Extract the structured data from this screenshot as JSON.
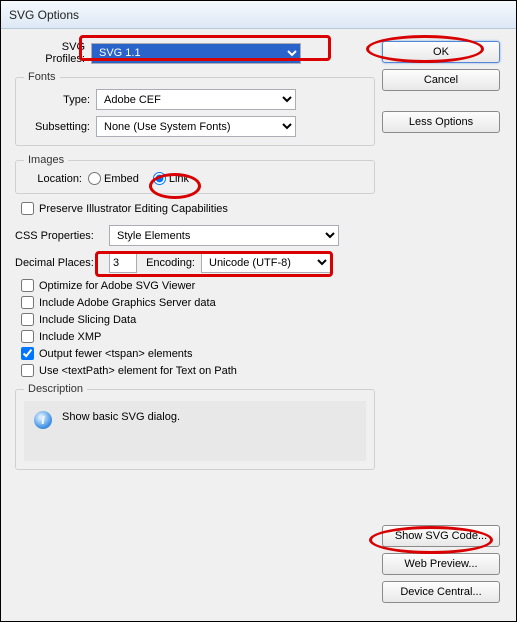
{
  "titlebar": {
    "title": "SVG Options"
  },
  "profiles": {
    "label": "SVG Profiles:",
    "value": "SVG 1.1"
  },
  "fonts": {
    "legend": "Fonts",
    "type_label": "Type:",
    "type_value": "Adobe CEF",
    "subsetting_label": "Subsetting:",
    "subsetting_value": "None (Use System Fonts)"
  },
  "images": {
    "legend": "Images",
    "location_label": "Location:",
    "embed_label": "Embed",
    "link_label": "Link"
  },
  "preserve_label": "Preserve Illustrator Editing Capabilities",
  "css": {
    "label": "CSS Properties:",
    "value": "Style Elements"
  },
  "decimal": {
    "label": "Decimal Places:",
    "value": "3"
  },
  "encoding": {
    "label": "Encoding:",
    "value": "Unicode (UTF-8)"
  },
  "opts": {
    "optimize_viewer": "Optimize for Adobe SVG Viewer",
    "include_graphics_server": "Include Adobe Graphics Server data",
    "include_slicing": "Include Slicing Data",
    "include_xmp": "Include XMP",
    "fewer_tspan": "Output fewer <tspan> elements",
    "textpath": "Use <textPath> element for Text on Path"
  },
  "description": {
    "legend": "Description",
    "text": "Show basic SVG dialog."
  },
  "buttons": {
    "ok": "OK",
    "cancel": "Cancel",
    "less_options": "Less Options",
    "show_svg": "Show SVG Code...",
    "web_preview": "Web Preview...",
    "device_central": "Device Central..."
  }
}
